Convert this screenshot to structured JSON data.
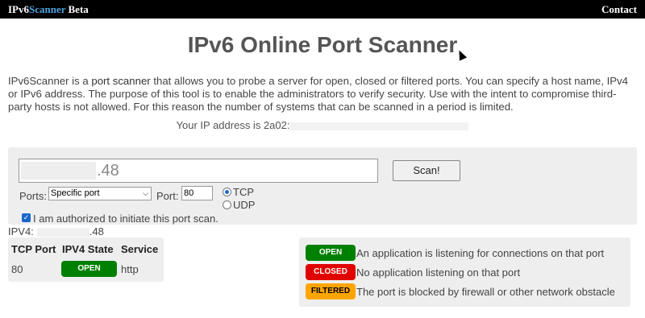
{
  "topbar": {
    "brand_ipv6": "IPv6",
    "brand_scanner": "Scanner",
    "brand_beta": " Beta",
    "contact": "Contact"
  },
  "title": "IPv6 Online Port Scanner",
  "intro": {
    "before_link": "IPv6Scanner is a ",
    "link": "port scanner",
    "after_link": " that allows you to probe a server for open, closed or filtered ports. You can specify a host name, IPv4 or IPv6 address. The purpose of this tool is to enable the administrators to verify security. Use with the intent to compromise third-party hosts is not allowed. For this reason the number of systems that can be scanned in a period is limited."
  },
  "your_ip": {
    "label": "Your IP address is 2a02:"
  },
  "form": {
    "host_value": ".48",
    "scan_label": "Scan!",
    "ports_label": "Ports:",
    "ports_selected": "Specific port",
    "port_label": "Port:",
    "port_value": "80",
    "protocols": [
      {
        "label": "TCP",
        "checked": true
      },
      {
        "label": "UDP",
        "checked": false
      }
    ],
    "authorized_label": "I am authorized to initiate this port scan.",
    "authorized_checked": true
  },
  "ipv4": {
    "label": "IPV4:",
    "value": ".48"
  },
  "results": {
    "headers": [
      "TCP Port",
      "IPV4 State",
      "Service"
    ],
    "rows": [
      {
        "port": "80",
        "state": "OPEN",
        "service": "http"
      }
    ]
  },
  "legend": [
    {
      "badge": "OPEN",
      "text": "An application is listening for connections on that port",
      "color": "#008000"
    },
    {
      "badge": "CLOSED",
      "text": "No application listening on that port",
      "color": "#e00000"
    },
    {
      "badge": "FILTERED",
      "text": "The port is blocked by firewall or other network obstacle",
      "color": "#ffa500"
    }
  ]
}
